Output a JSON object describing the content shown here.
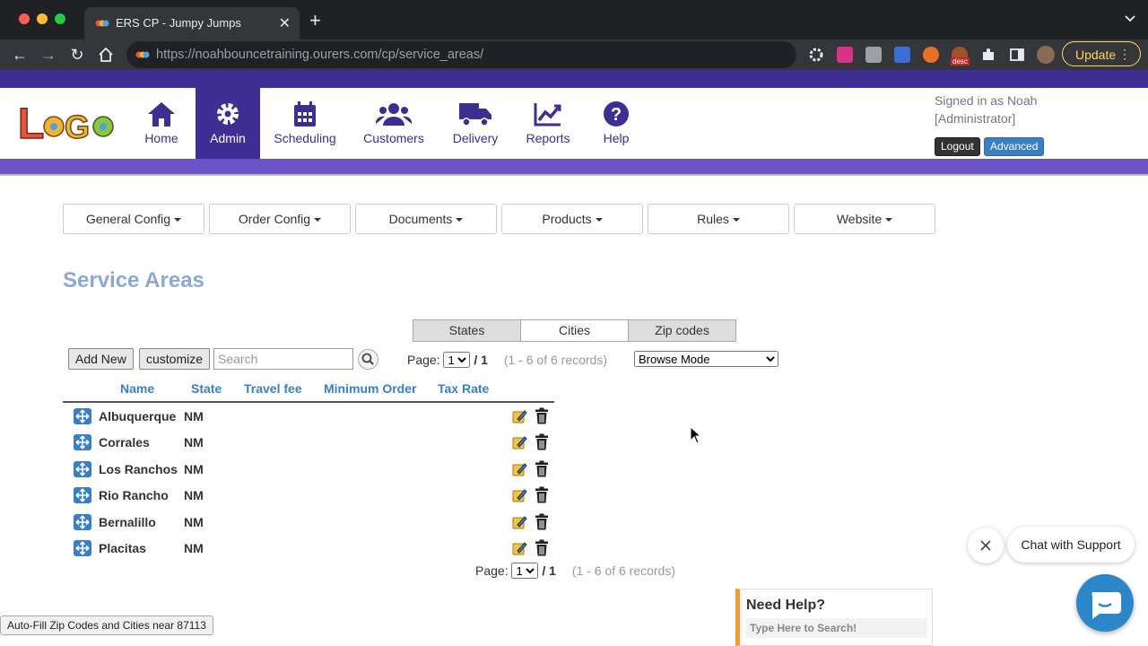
{
  "browser": {
    "tab_title": "ERS CP - Jumpy Jumps",
    "url_host": "https://noahbouncetraining.ourers.com",
    "url_path": "/cp/service_areas/",
    "update_label": "Update",
    "ext_badge": "desc"
  },
  "header": {
    "nav": [
      {
        "label": "Home",
        "icon": "home-icon"
      },
      {
        "label": "Admin",
        "icon": "gear-icon",
        "active": true
      },
      {
        "label": "Scheduling",
        "icon": "calendar-icon"
      },
      {
        "label": "Customers",
        "icon": "users-icon"
      },
      {
        "label": "Delivery",
        "icon": "truck-icon"
      },
      {
        "label": "Reports",
        "icon": "chart-icon"
      },
      {
        "label": "Help",
        "icon": "question-icon"
      }
    ],
    "signed_in_line1": "Signed in as Noah",
    "signed_in_line2": "[Administrator]",
    "logout_label": "Logout",
    "advanced_label": "Advanced",
    "colors": {
      "stripe": "#3f2f94",
      "accent": "#6a55c8"
    }
  },
  "config_menu": [
    "General Config",
    "Order Config",
    "Documents",
    "Products",
    "Rules",
    "Website"
  ],
  "page": {
    "title": "Service Areas",
    "tabs": [
      {
        "label": "States",
        "active": false
      },
      {
        "label": "Cities",
        "active": true
      },
      {
        "label": "Zip codes",
        "active": false
      }
    ],
    "add_new_label": "Add New",
    "customize_label": "customize",
    "search_placeholder": "Search",
    "page_label": "Page:",
    "page_value": "1",
    "page_total": "/ 1",
    "records": "(1 - 6 of 6 records)",
    "mode": "Browse Mode"
  },
  "table": {
    "columns": [
      "Name",
      "State",
      "Travel fee",
      "Minimum Order",
      "Tax Rate"
    ],
    "rows": [
      {
        "name": "Albuquerque",
        "state": "NM"
      },
      {
        "name": "Corrales",
        "state": "NM"
      },
      {
        "name": "Los Ranchos",
        "state": "NM"
      },
      {
        "name": "Rio Rancho",
        "state": "NM"
      },
      {
        "name": "Bernalillo",
        "state": "NM"
      },
      {
        "name": "Placitas",
        "state": "NM"
      }
    ]
  },
  "status": "Auto-Fill Zip Codes and Cities near 87113",
  "chat": {
    "label": "Chat with Support",
    "help_title": "Need Help?",
    "help_placeholder": "Type Here to Search!"
  }
}
